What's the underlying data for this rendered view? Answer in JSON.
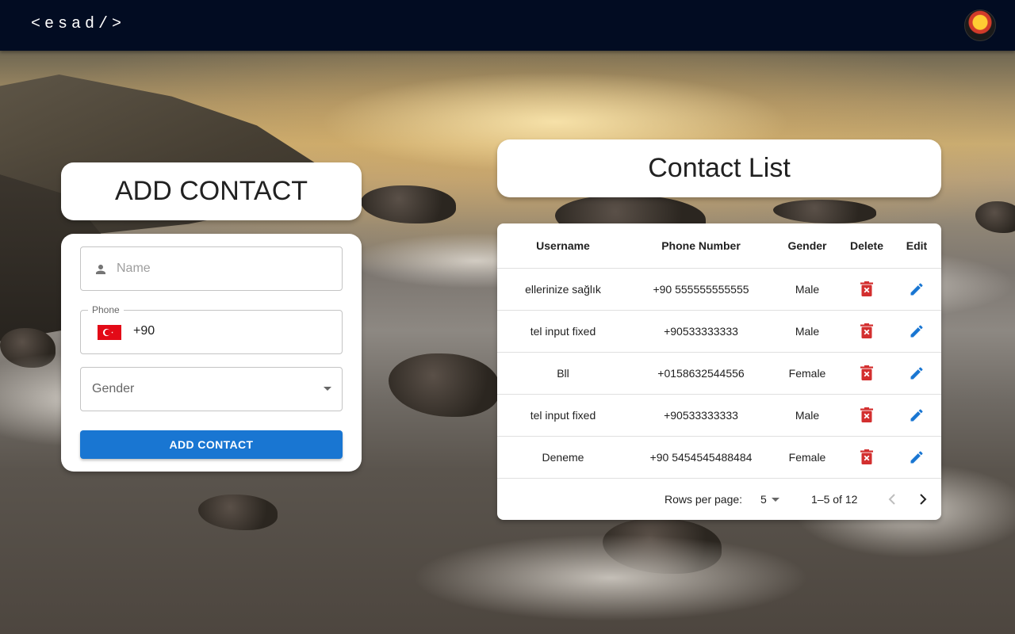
{
  "appbar": {
    "brand": "<esad/>"
  },
  "add_contact": {
    "title": "ADD CONTACT",
    "name_placeholder": "Name",
    "phone_label": "Phone",
    "phone_value": "+90",
    "gender_placeholder": "Gender",
    "submit_label": "ADD CONTACT"
  },
  "contact_list": {
    "title": "Contact List",
    "headers": [
      "Username",
      "Phone Number",
      "Gender",
      "Delete",
      "Edit"
    ],
    "rows": [
      {
        "username": "ellerinize sağlık",
        "phone": "+90 555555555555",
        "gender": "Male"
      },
      {
        "username": "tel input fixed",
        "phone": "+90533333333",
        "gender": "Male"
      },
      {
        "username": "Bll",
        "phone": "+0158632544556",
        "gender": "Female"
      },
      {
        "username": "tel input fixed",
        "phone": "+90533333333",
        "gender": "Male"
      },
      {
        "username": "Deneme",
        "phone": "+90 5454545488484",
        "gender": "Female"
      }
    ],
    "pagination": {
      "rows_per_page_label": "Rows per page:",
      "rows_per_page": "5",
      "range": "1–5 of 12"
    }
  },
  "icons": {
    "delete": "trash-icon",
    "edit": "pencil-icon",
    "person": "person-icon",
    "flag": "turkey-flag-icon"
  },
  "colors": {
    "appbar": "#020c22",
    "primary": "#1976d2",
    "delete": "#d32f2f"
  }
}
